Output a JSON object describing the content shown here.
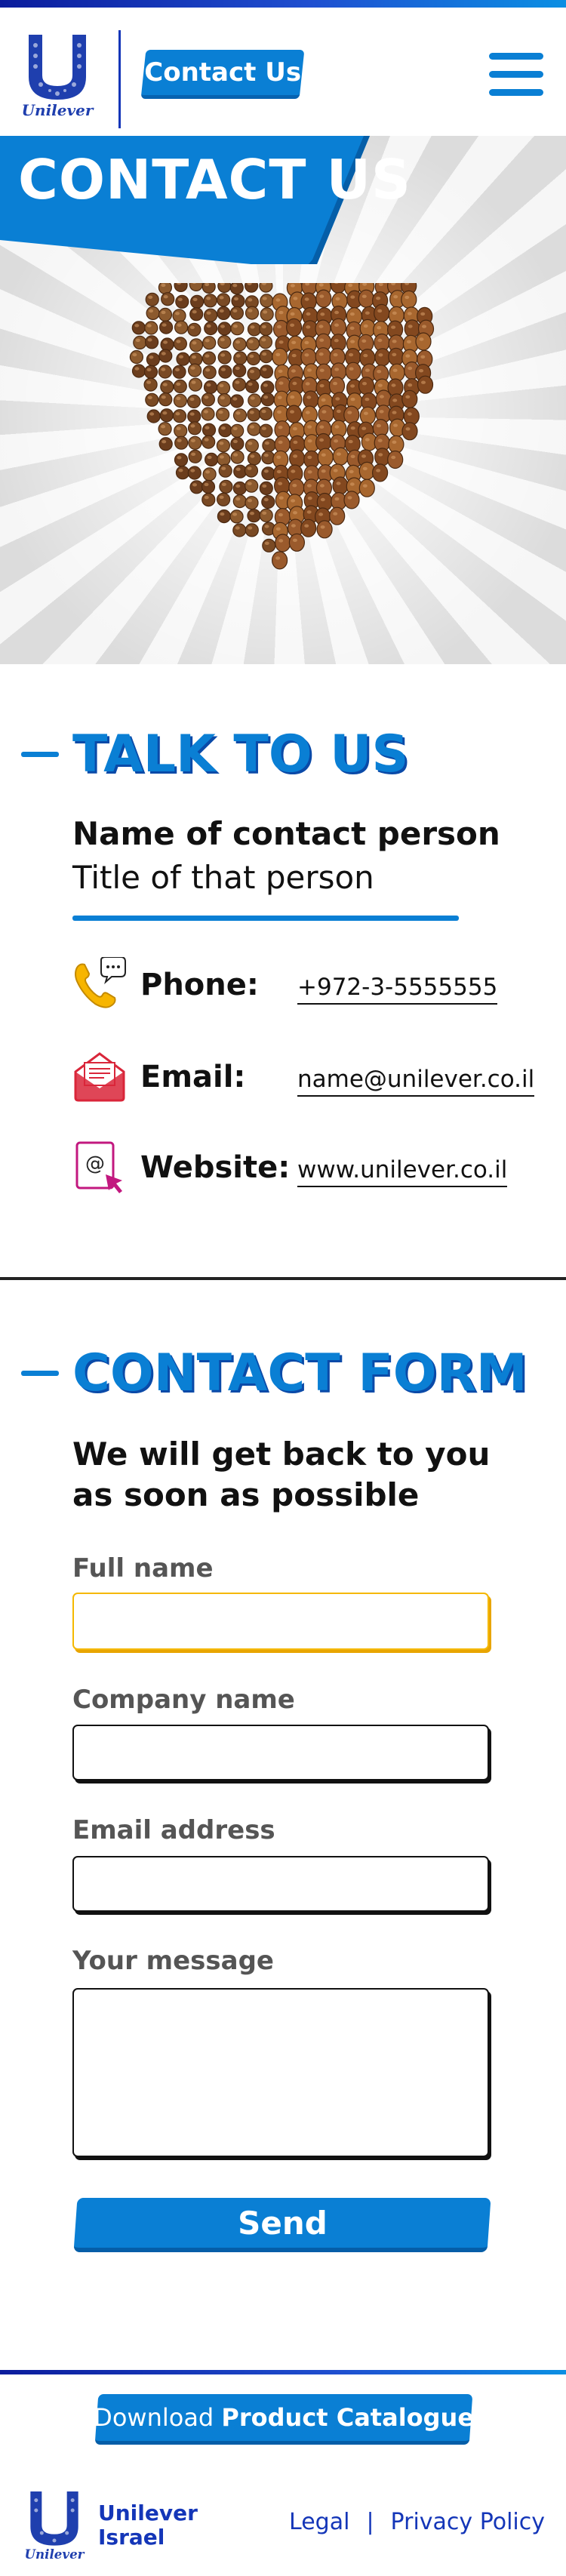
{
  "header": {
    "logo_text": "Unilever",
    "tag_label": "Contact Us",
    "menu_icon": "hamburger-menu-icon"
  },
  "hero": {
    "title": "CONTACT US",
    "image": "chocolate-heart-image"
  },
  "talk": {
    "heading": "TALK TO US",
    "contact_name": "Name of contact person",
    "contact_title": "Title of that person",
    "rows": [
      {
        "icon": "phone-icon",
        "label": "Phone:",
        "value": "+972-3-5555555"
      },
      {
        "icon": "email-icon",
        "label": "Email:",
        "value": "name@unilever.co.il"
      },
      {
        "icon": "website-icon",
        "label": "Website:",
        "value": "www.unilever.co.il"
      }
    ]
  },
  "form": {
    "heading": "CONTACT FORM",
    "subtitle": "We will get back to you as soon as possible",
    "fields": [
      {
        "label": "Full name",
        "value": "",
        "placeholder": ""
      },
      {
        "label": "Company name",
        "value": "",
        "placeholder": ""
      },
      {
        "label": "Email address",
        "value": "",
        "placeholder": ""
      },
      {
        "label": "Your message",
        "value": "",
        "placeholder": ""
      }
    ],
    "send_label": "Send"
  },
  "footer": {
    "download_prefix": "Download ",
    "download_strong": "Product Catalogue",
    "brand_line1": "Unilever",
    "brand_line2": "Israel",
    "logo_text": "Unilever",
    "links": [
      "Legal",
      "Privacy Policy"
    ],
    "link_separator": "|"
  },
  "colors": {
    "brand_blue": "#0a7fd4",
    "dark_blue": "#1436b8",
    "focus_yellow": "#f5b800",
    "email_red": "#d9263a",
    "website_magenta": "#c2187f",
    "phone_yellow": "#f7b500"
  }
}
